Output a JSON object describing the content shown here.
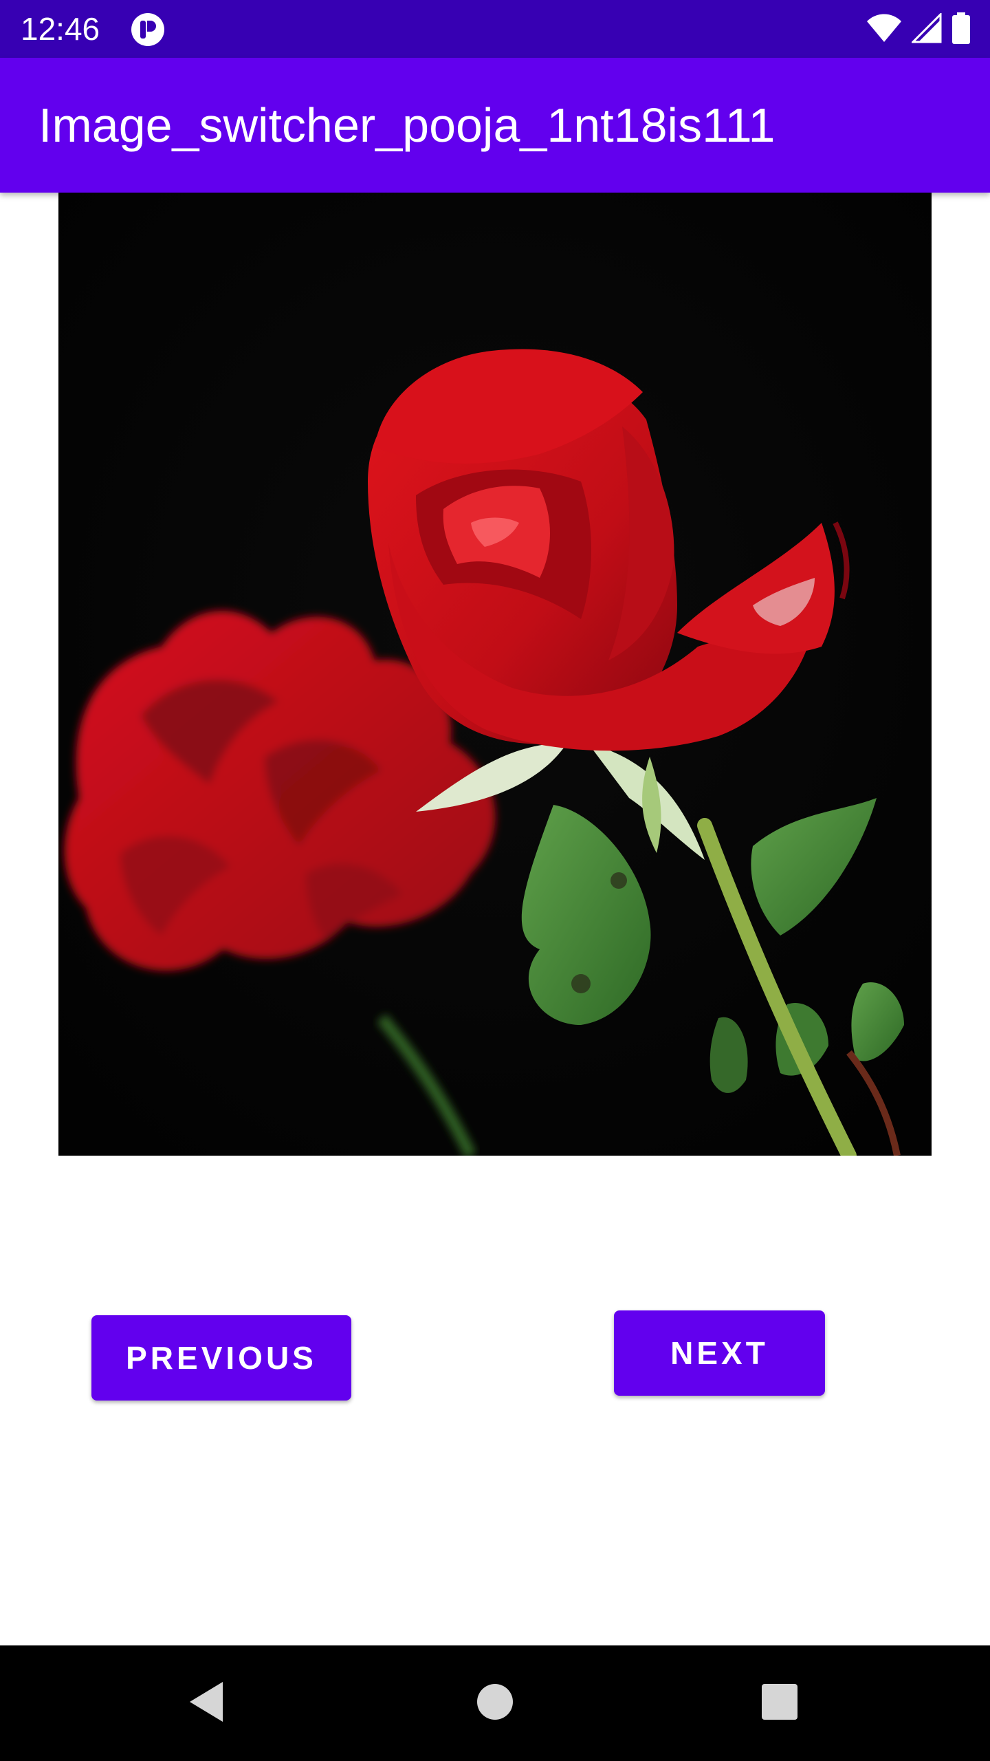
{
  "status_bar": {
    "time": "12:46",
    "icons": [
      "app-notification-icon",
      "wifi-icon",
      "cellular-signal-icon",
      "battery-icon"
    ]
  },
  "app_bar": {
    "title": "Image_switcher_pooja_1nt18is111"
  },
  "image_switcher": {
    "content": "rose-photo"
  },
  "buttons": {
    "previous_label": "PREVIOUS",
    "next_label": "NEXT"
  },
  "nav_bar": {
    "icons": [
      "back-icon",
      "home-icon",
      "recents-icon"
    ]
  },
  "colors": {
    "status_bar": "#3700b3",
    "app_bar": "#6200ee",
    "button": "#6200ee",
    "nav_bar": "#000000"
  }
}
